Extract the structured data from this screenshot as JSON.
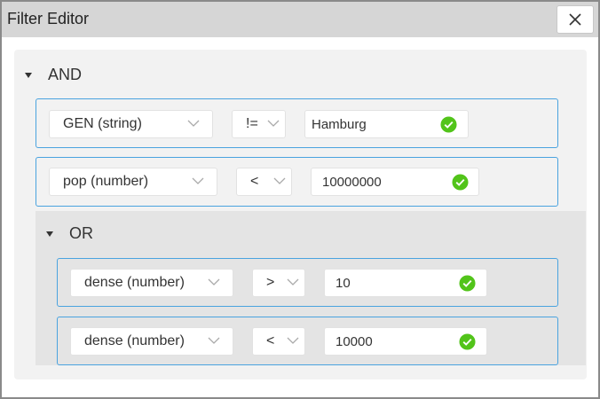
{
  "window": {
    "title": "Filter Editor"
  },
  "root_group": {
    "operator": "AND",
    "rules": [
      {
        "field": "GEN (string)",
        "operator": "!=",
        "value": "Hamburg"
      },
      {
        "field": "pop (number)",
        "operator": "<",
        "value": "10000000"
      }
    ],
    "subgroup": {
      "operator": "OR",
      "rules": [
        {
          "field": "dense (number)",
          "operator": ">",
          "value": "10"
        },
        {
          "field": "dense (number)",
          "operator": "<",
          "value": "10000"
        }
      ]
    }
  },
  "colors": {
    "accent_border": "#4aa3df",
    "valid_check": "#52c41a"
  },
  "icons": [
    "close-icon",
    "caret-down-icon",
    "chevron-down-icon",
    "check-circle-icon"
  ]
}
